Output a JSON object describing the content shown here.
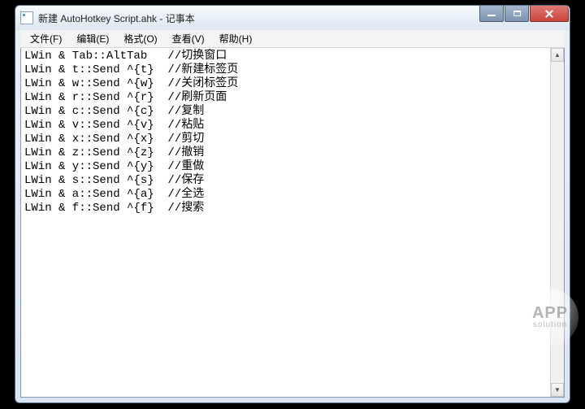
{
  "title": "新建 AutoHotkey Script.ahk - 记事本",
  "menus": {
    "file": "文件(F)",
    "edit": "编辑(E)",
    "format": "格式(O)",
    "view": "查看(V)",
    "help": "帮助(H)"
  },
  "content_lines": [
    "LWin & Tab::AltTab   //切换窗口",
    "LWin & t::Send ^{t}  //新建标签页",
    "LWin & w::Send ^{w}  //关闭标签页",
    "LWin & r::Send ^{r}  //刷新页面",
    "LWin & c::Send ^{c}  //复制",
    "LWin & v::Send ^{v}  //粘贴",
    "LWin & x::Send ^{x}  //剪切",
    "LWin & z::Send ^{z}  //撤销",
    "LWin & y::Send ^{y}  //重做",
    "LWin & s::Send ^{s}  //保存",
    "LWin & a::Send ^{a}  //全选",
    "LWin & f::Send ^{f}  //搜索"
  ],
  "watermark": {
    "line1": "APP",
    "line2": "solution"
  }
}
